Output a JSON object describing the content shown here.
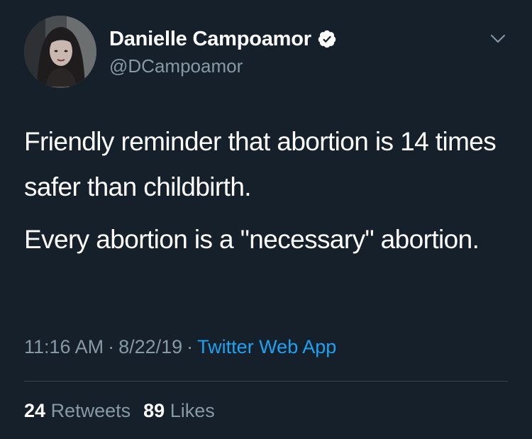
{
  "author": {
    "display_name": "Danielle Campoamor",
    "handle": "@DCampoamor",
    "verified": true
  },
  "icons": {
    "verified": "verified-badge-icon",
    "menu": "chevron-down-icon"
  },
  "tweet": {
    "paragraph_1": "Friendly reminder that abortion is 14 times safer than childbirth.",
    "paragraph_2": "Every abortion is a \"necessary\" abortion."
  },
  "meta": {
    "time": "11:16 AM",
    "separator": "·",
    "date": "8/22/19",
    "source": "Twitter Web App"
  },
  "stats": {
    "retweets_count": "24",
    "retweets_label": "Retweets",
    "likes_count": "89",
    "likes_label": "Likes"
  },
  "colors": {
    "background": "#15202b",
    "text_primary": "#ffffff",
    "text_secondary": "#8899a6",
    "link": "#1da1f2",
    "divider": "#38444d"
  }
}
